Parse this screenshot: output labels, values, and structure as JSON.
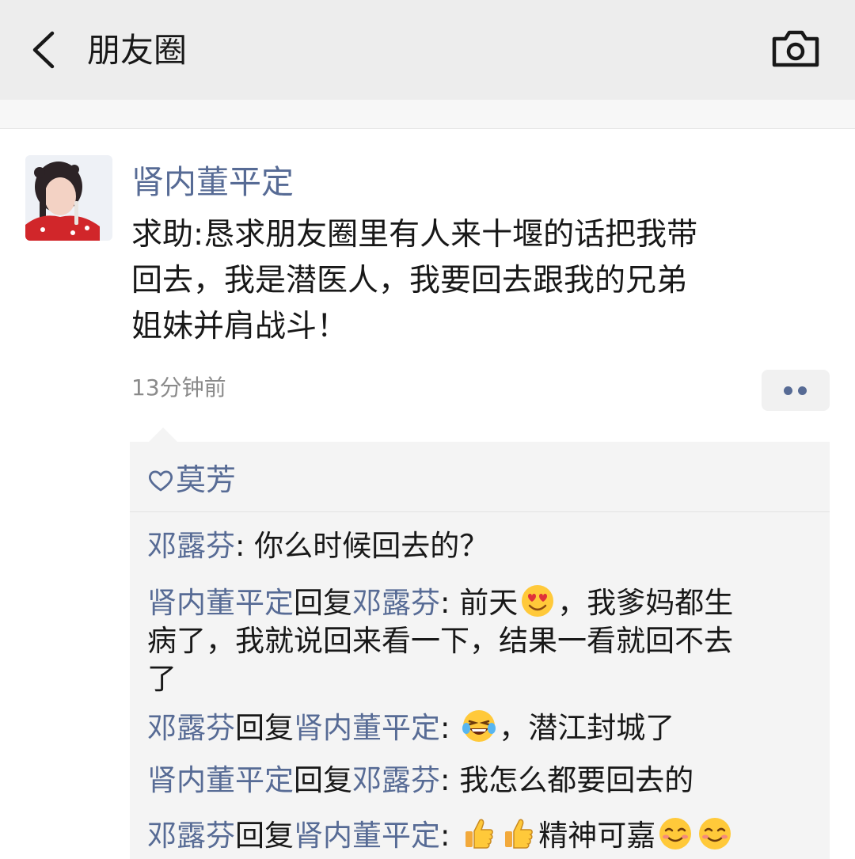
{
  "header": {
    "title": "朋友圈",
    "back_icon": "chevron-left-icon",
    "camera_icon": "camera-icon"
  },
  "post": {
    "author": "肾内董平定",
    "text_lines": [
      "求助:恳求朋友圈里有人来十堰的话把我带",
      "回去，我是潜医人，我要回去跟我的兄弟",
      "姐妹并肩战斗！"
    ],
    "time": "13分钟前"
  },
  "likes": {
    "icon": "heart-outline-icon",
    "names": "莫芳"
  },
  "comments": [
    {
      "from": "邓露芬",
      "text": ": 你么时候回去的？"
    },
    {
      "from": "肾内董平定",
      "reply_word": "回复",
      "to": "邓露芬",
      "sep": ": ",
      "t1": "前天",
      "emoji1": "heart-eyes-emoji",
      "t2": "，我爹妈都生",
      "line2": "病了，我就说回来看一下，结果一看就回不去",
      "line3": "了"
    },
    {
      "from": "邓露芬",
      "reply_word": "回复",
      "to": "肾内董平定",
      "sep": ": ",
      "emoji1": "laughing-tears-emoji",
      "t2": "，潜江封城了"
    },
    {
      "from": "肾内董平定",
      "reply_word": "回复",
      "to": "邓露芬",
      "text": ": 我怎么都要回去的"
    },
    {
      "from": "邓露芬",
      "reply_word": "回复",
      "to": "肾内董平定",
      "sep": ": ",
      "emoji1": "thumbs-up-emoji",
      "emoji2": "thumbs-up-emoji",
      "t2": "精神可嘉",
      "emoji3": "smiling-face-emoji",
      "emoji4": "smiling-face-emoji"
    }
  ],
  "colors": {
    "name_blue": "#576b95",
    "header_bg": "#ededed",
    "comment_bg": "#f4f4f4",
    "time_gray": "#8a8a8a"
  }
}
